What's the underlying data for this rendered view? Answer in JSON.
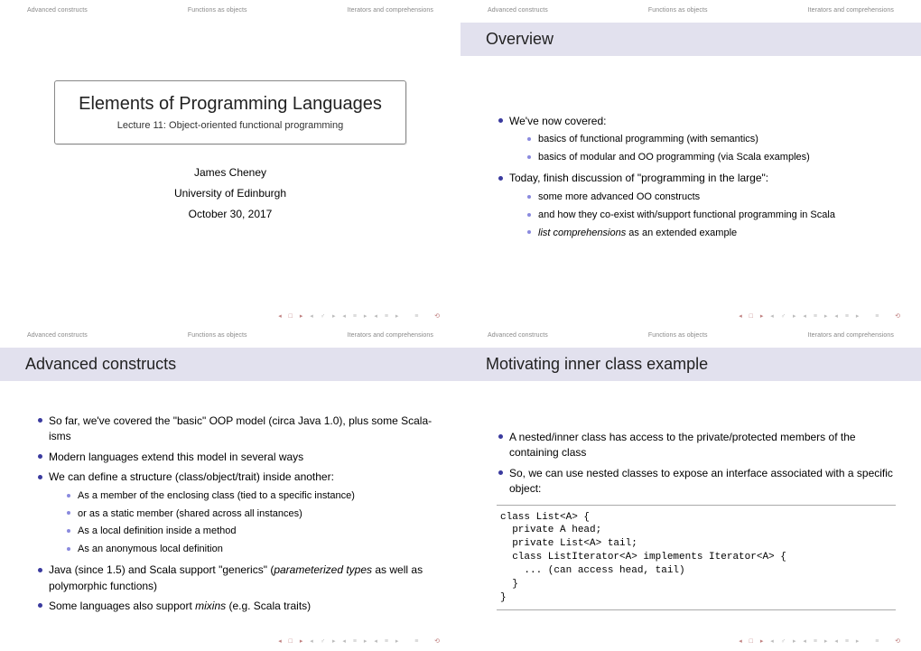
{
  "nav": {
    "a": "Advanced constructs",
    "b": "Functions as objects",
    "c": "Iterators and comprehensions"
  },
  "title": {
    "main": "Elements of Programming Languages",
    "sub": "Lecture 11: Object-oriented functional programming",
    "author": "James Cheney",
    "institution": "University of Edinburgh",
    "date": "October 30, 2017"
  },
  "overview": {
    "header": "Overview",
    "l1": "We've now covered:",
    "s1": "basics of functional programming (with semantics)",
    "s2": "basics of modular and OO programming (via Scala examples)",
    "l2": "Today, finish discussion of \"programming in the large\":",
    "s3": "some more advanced OO constructs",
    "s4": "and how they co-exist with/support functional programming in Scala",
    "s5a": "list comprehensions",
    "s5b": " as an extended example"
  },
  "advanced": {
    "header": "Advanced constructs",
    "l1": "So far, we've covered the \"basic\" OOP model (circa Java 1.0), plus some Scala-isms",
    "l2": "Modern languages extend this model in several ways",
    "l3": "We can define a structure (class/object/trait) inside another:",
    "s1": "As a member of the enclosing class (tied to a specific instance)",
    "s2": "or as a static member (shared across all instances)",
    "s3": "As a local definition inside a method",
    "s4": "As an anonymous local definition",
    "l4a": "Java (since 1.5) and Scala support \"generics\" (",
    "l4b": "parameterized types",
    "l4c": " as well as polymorphic functions)",
    "l5a": "Some languages also support ",
    "l5b": "mixins",
    "l5c": " (e.g. Scala traits)"
  },
  "motivating": {
    "header": "Motivating inner class example",
    "l1": "A nested/inner class has access to the private/protected members of the containing class",
    "l2": "So, we can use nested classes to expose an interface associated with a specific object:",
    "code": "class List<A> {\n  private A head;\n  private List<A> tail;\n  class ListIterator<A> implements Iterator<A> {\n    ... (can access head, tail)\n  }\n}"
  },
  "footer_icons": "◂ □ ▸ ◂ ♂ ▸ ◂ ≡ ▸ ◂ ≡ ▸   ≡   ⟲"
}
